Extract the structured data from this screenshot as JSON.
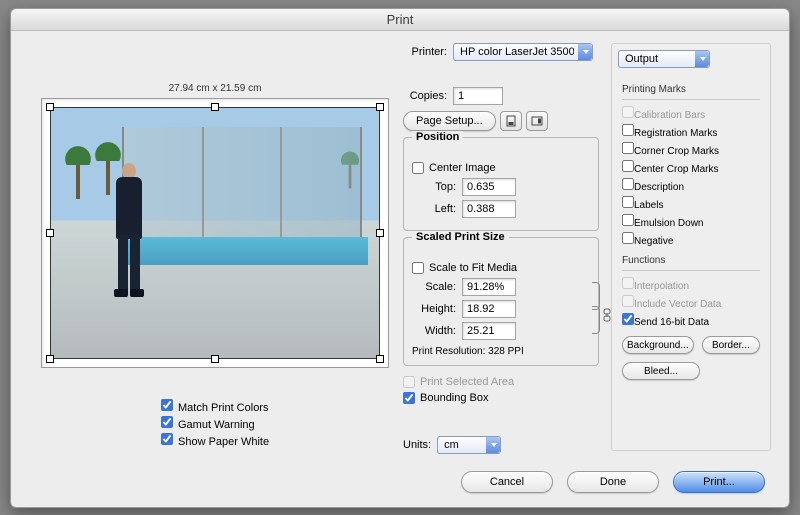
{
  "title": "Print",
  "printer": {
    "label": "Printer:",
    "value": "HP color LaserJet 3500 @..."
  },
  "preview": {
    "dimensions": "27.94 cm x 21.59 cm"
  },
  "copies": {
    "label": "Copies:",
    "value": "1"
  },
  "page_setup_label": "Page Setup...",
  "position": {
    "legend": "Position",
    "center_label": "Center Image",
    "top_label": "Top:",
    "top_value": "0.635",
    "left_label": "Left:",
    "left_value": "0.388"
  },
  "scaled": {
    "legend": "Scaled Print Size",
    "fit_label": "Scale to Fit Media",
    "scale_label": "Scale:",
    "scale_value": "91.28%",
    "height_label": "Height:",
    "height_value": "18.92",
    "width_label": "Width:",
    "width_value": "25.21",
    "res_label": "Print Resolution: 328 PPI"
  },
  "lower": {
    "psa_label": "Print Selected Area",
    "bbox_label": "Bounding Box",
    "units_label": "Units:",
    "units_value": "cm"
  },
  "lhs_checks": {
    "match": "Match Print Colors",
    "gamut": "Gamut Warning",
    "paper": "Show Paper White"
  },
  "rhs": {
    "dropdown": "Output",
    "marks_h": "Printing Marks",
    "marks": {
      "cal": "Calibration Bars",
      "reg": "Registration Marks",
      "ccm": "Corner Crop Marks",
      "cecm": "Center Crop Marks",
      "desc": "Description",
      "labels": "Labels",
      "emul": "Emulsion Down",
      "neg": "Negative"
    },
    "funcs_h": "Functions",
    "funcs": {
      "interp": "Interpolation",
      "vector": "Include Vector Data",
      "sixteen": "Send 16-bit Data"
    },
    "btns": {
      "bg": "Background...",
      "border": "Border...",
      "bleed": "Bleed..."
    }
  },
  "footer": {
    "cancel": "Cancel",
    "done": "Done",
    "print": "Print..."
  }
}
